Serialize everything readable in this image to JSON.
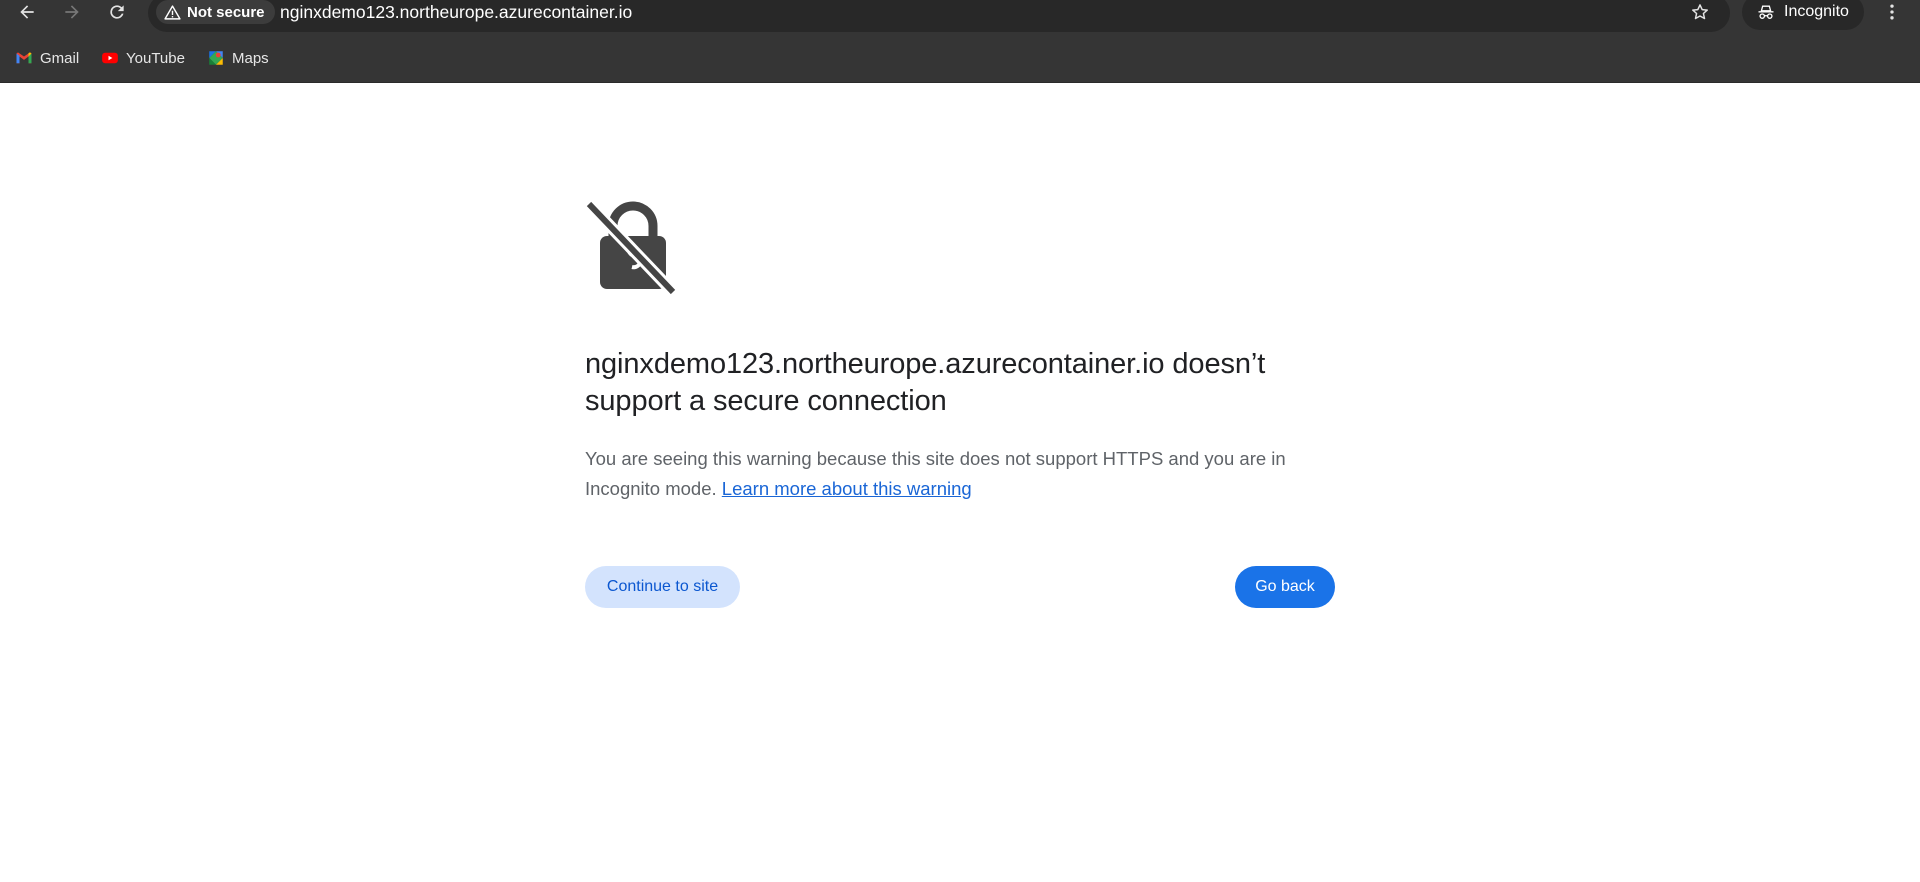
{
  "browser": {
    "security_label": "Not secure",
    "url": "nginxdemo123.northeurope.azurecontainer.io",
    "profile_label": "Incognito",
    "bookmarks": [
      {
        "label": "Gmail",
        "icon": "gmail-icon"
      },
      {
        "label": "YouTube",
        "icon": "youtube-icon"
      },
      {
        "label": "Maps",
        "icon": "maps-icon"
      }
    ],
    "colors": {
      "toolbar_bg": "#353535",
      "omnibox_bg": "#282828"
    }
  },
  "interstitial": {
    "icon": "lock-slash-icon",
    "heading": "nginxdemo123.northeurope.azurecontainer.io doesn’t support a secure connection",
    "body": "You are seeing this warning because this site does not support HTTPS and you are in Incognito mode.",
    "link_text": "Learn more about this warning",
    "continue_label": "Continue to site",
    "back_label": "Go back",
    "colors": {
      "primary_button": "#1a73e8",
      "secondary_button": "#d3e3fd",
      "link": "#1a66d6"
    }
  }
}
